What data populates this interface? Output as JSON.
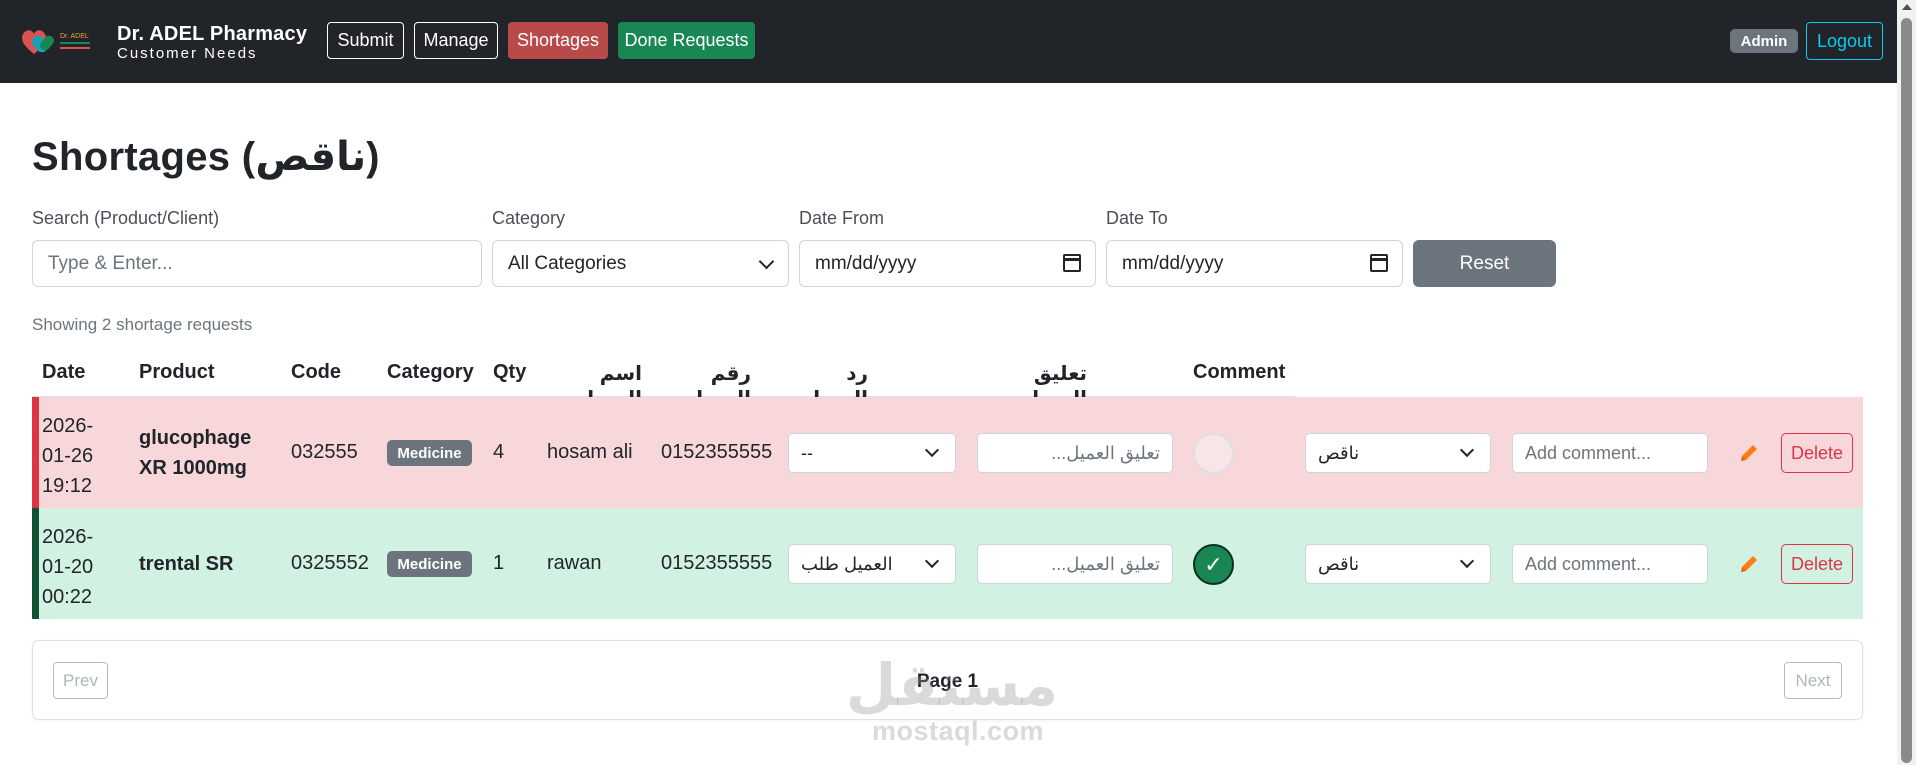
{
  "nav": {
    "brand_logo_text": "Dr. ADEL",
    "brand_title": "Dr. ADEL Pharmacy",
    "brand_subtitle": "Customer Needs",
    "buttons": {
      "submit": "Submit",
      "manage": "Manage",
      "shortages": "Shortages",
      "done": "Done Requests"
    },
    "admin": "Admin",
    "logout": "Logout"
  },
  "page": {
    "title": "Shortages (ناقص)"
  },
  "filters": {
    "search_label": "Search (Product/Client)",
    "search_placeholder": "Type & Enter...",
    "category_label": "Category",
    "category_value": "All Categories",
    "date_from_label": "Date From",
    "date_from_value": "mm/dd/yyyy",
    "date_to_label": "Date To",
    "date_to_value": "mm/dd/yyyy",
    "reset": "Reset"
  },
  "showing": "Showing 2 shortage requests",
  "table": {
    "headers": [
      "Date",
      "Product",
      "Code",
      "Category",
      "Qty",
      "اسم العميل",
      "رقم العميل",
      "رد العميل",
      "تعليق العميل",
      "Comment"
    ],
    "rows": [
      {
        "date_line1": "2026-",
        "date_line2": "01-26",
        "date_line3": "19:12",
        "product_line1": "glucophage",
        "product_line2": "XR 1000mg",
        "code": "032555",
        "category": "Medicine",
        "qty": "4",
        "client_name": "hosam ali",
        "client_phone": "0152355555",
        "client_reply": "--",
        "client_comment_placeholder": "تعليق العميل...",
        "status": "ناقص",
        "comment_placeholder": "Add comment...",
        "done": false,
        "delete": "Delete",
        "status_color": "#dc3545"
      },
      {
        "date_line1": "2026-",
        "date_line2": "01-20",
        "date_line3": "00:22",
        "product_line1": "trental SR",
        "product_line2": "",
        "code": "0325552",
        "category": "Medicine",
        "qty": "1",
        "client_name": "rawan",
        "client_phone": "0152355555",
        "client_reply": "العميل طلب",
        "client_comment_placeholder": "تعليق العميل...",
        "status": "ناقص",
        "comment_placeholder": "Add comment...",
        "done": true,
        "check": "✓",
        "delete": "Delete",
        "status_color": "#0f5132"
      }
    ]
  },
  "pagination": {
    "prev": "Prev",
    "page": "Page 1",
    "next": "Next"
  },
  "watermark": {
    "arabic": "مستقل",
    "latin": "mostaql.com"
  },
  "icons": {
    "logo": "heart-pills-logo-icon",
    "edit": "pencil-icon",
    "select": "chevron-down-icon",
    "date": "calendar-icon"
  }
}
